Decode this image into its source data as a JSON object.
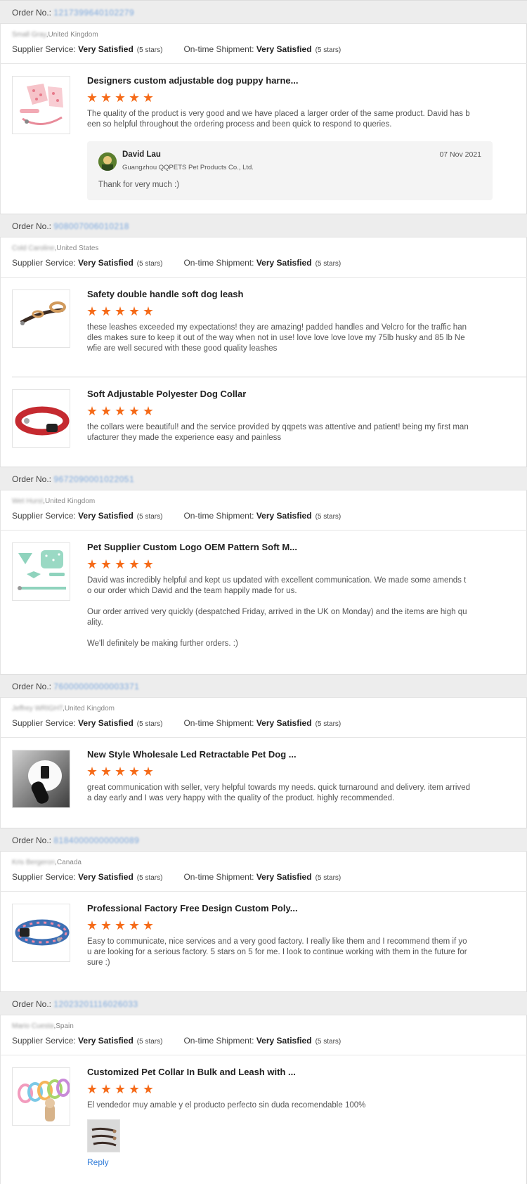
{
  "labels": {
    "order_no": "Order No.:",
    "supplier_service": "Supplier Service:",
    "ontime_shipment": "On-time Shipment:",
    "reply_link": "Reply"
  },
  "colors": {
    "star": "#f56a18",
    "order_no_link": "#7aa7dd",
    "reply_link": "#2f7bd8",
    "header_bg": "#ededed"
  },
  "orders": [
    {
      "order_no_hidden": "12173996401022",
      "order_no_visible": "79",
      "buyer_name": "Small Gray",
      "buyer_country": ",United Kingdom",
      "supplier_service": "Very Satisfied",
      "supplier_stars": "(5 stars)",
      "ontime_shipment": "Very Satisfied",
      "ontime_stars": "(5 stars)",
      "items": [
        {
          "title": "Designers custom adjustable dog puppy harne...",
          "rating": 5,
          "thumbnail": "pink-dog-harness-image",
          "comment": [
            "The quality of the product is very good and we have placed a larger order of the same product. David has been so helpful throughout the ordering process and been quick to respond to queries."
          ]
        }
      ],
      "reply": {
        "name": "David Lau",
        "company": "Guangzhou QQPETS Pet Products Co., Ltd.",
        "date": "07 Nov 2021",
        "text": "Thank for very much :)"
      }
    },
    {
      "order_no_visible_prefix": "90",
      "order_no_hidden": "8007006010218",
      "buyer_name": "Cold Caroline",
      "buyer_country": ",United States",
      "supplier_service": "Very Satisfied",
      "supplier_stars": "(5 stars)",
      "ontime_shipment": "Very Satisfied",
      "ontime_stars": "(5 stars)",
      "items": [
        {
          "title": "Safety double handle soft dog leash",
          "rating": 5,
          "thumbnail": "double-handle-leash-image",
          "comment": [
            "these leashes exceeded my expectations! they are amazing! padded handles and Velcro for the traffic handles makes sure to keep it out of the way when not in use! love love love love my 75lb husky and 85 lb Newfie are well secured with these good quality leashes"
          ]
        },
        {
          "title": "Soft Adjustable Polyester Dog Collar",
          "rating": 5,
          "thumbnail": "red-collar-image",
          "comment": [
            "the collars were beautiful! and the service provided by qqpets was attentive and patient! being my first manufacturer they made the experience easy and painless"
          ]
        }
      ]
    },
    {
      "order_no_hidden": "9672090001022",
      "order_no_visible": "051",
      "buyer_name": "Wet Hurst",
      "buyer_country": ",United Kingdom",
      "supplier_service": "Very Satisfied",
      "supplier_stars": "(5 stars)",
      "ontime_shipment": "Very Satisfied",
      "ontime_stars": "(5 stars)",
      "items": [
        {
          "title": "Pet Supplier Custom Logo OEM Pattern Soft M...",
          "rating": 5,
          "thumbnail": "green-pattern-harness-set-image",
          "comment": [
            "David was incredibly helpful and kept us updated with excellent communication. We made some amends to our order which David and the team happily made for us.",
            "Our order arrived very quickly (despatched Friday, arrived in the UK on Monday) and the items are high quality.",
            "We'll definitely be making further orders. :)"
          ]
        }
      ]
    },
    {
      "order_no_visible_prefix": "76",
      "order_no_hidden": "0000000000033",
      "order_no_visible": "71",
      "buyer_name": "Jeffrey WRIGHT",
      "buyer_country": ",United Kingdom",
      "supplier_service": "Very Satisfied",
      "supplier_stars": "(5 stars)",
      "ontime_shipment": "Very Satisfied",
      "ontime_stars": "(5 stars)",
      "items": [
        {
          "title": "New Style Wholesale Led Retractable Pet Dog ...",
          "rating": 5,
          "thumbnail": "retractable-leash-image",
          "comment": [
            "great communication with seller, very helpful towards my needs. quick turnaround and delivery. item arrived a day early and I was very happy with the quality of the product. highly recommended."
          ]
        }
      ]
    },
    {
      "order_no_visible_prefix": "81",
      "order_no_hidden": "8400000000000",
      "order_no_visible": "89",
      "buyer_name": "Kris Bergeron",
      "buyer_country": ",Canada",
      "supplier_service": "Very Satisfied",
      "supplier_stars": "(5 stars)",
      "ontime_shipment": "Very Satisfied",
      "ontime_stars": "(5 stars)",
      "items": [
        {
          "title": "Professional Factory Free Design Custom Poly...",
          "rating": 5,
          "thumbnail": "printed-collar-image",
          "comment": [
            "Easy to communicate, nice services and a very good factory. I really like them and I recommend them if you are looking for a serious factory. 5 stars on 5 for me. I look to continue working with them in the future for sure :)"
          ]
        }
      ]
    },
    {
      "order_no_hidden": "120232011160260",
      "order_no_visible": "33",
      "buyer_name": "Mario Cuesta",
      "buyer_country": ",Spain",
      "supplier_service": "Very Satisfied",
      "supplier_stars": "(5 stars)",
      "ontime_shipment": "Very Satisfied",
      "ontime_stars": "(5 stars)",
      "items": [
        {
          "title": "Customized Pet Collar In Bulk and Leash with ...",
          "rating": 5,
          "thumbnail": "collar-set-bulk-image",
          "comment": [
            "El vendedor muy amable y el producto perfecto sin duda recomendable 100%"
          ],
          "attachment": "review-photo-leashes"
        }
      ]
    }
  ]
}
